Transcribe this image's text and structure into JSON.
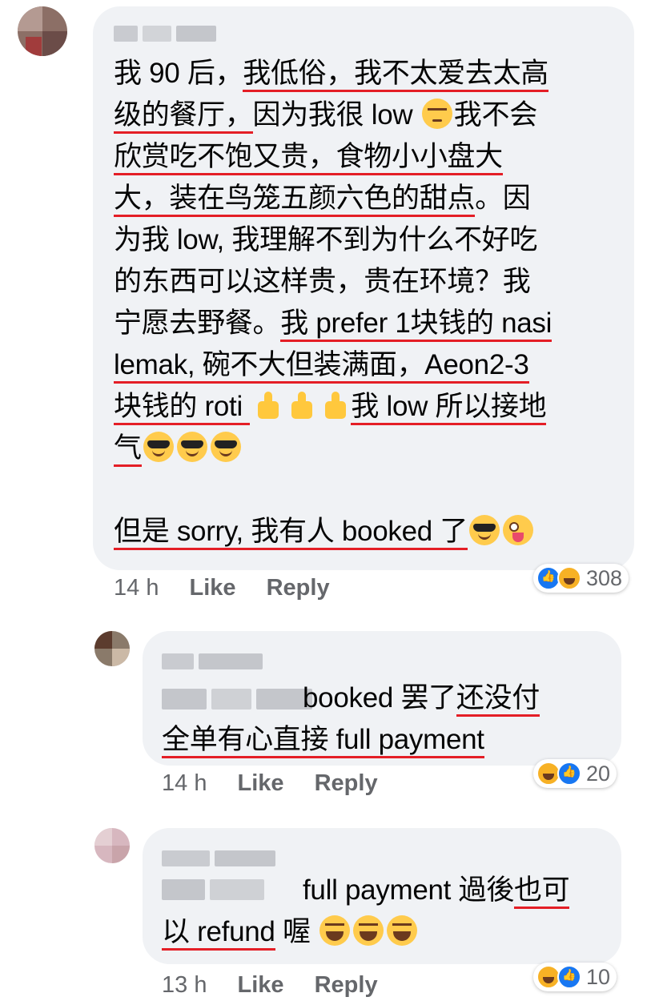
{
  "comments": [
    {
      "lines": [
        [
          {
            "t": "我 90 后，"
          },
          {
            "t": "我低俗，我不太爱去太高",
            "u": true
          }
        ],
        [
          {
            "t": "级的餐厅，",
            "u": true
          },
          {
            "t": "因为我很 low "
          },
          {
            "e": "unamused"
          },
          {
            "t": "我不会"
          }
        ],
        [
          {
            "t": "欣赏吃不饱又贵，食物小小盘大",
            "u": true
          }
        ],
        [
          {
            "t": "大，装在鸟笼五颜六色的甜点",
            "u": true
          },
          {
            "t": "。因"
          }
        ],
        [
          {
            "t": "为我 low, 我理解不到为什么不好吃"
          }
        ],
        [
          {
            "t": "的东西可以这样贵，贵在环境？我"
          }
        ],
        [
          {
            "t": "宁愿去野餐。"
          },
          {
            "t": "我 prefer 1块钱的 nasi",
            "u": true
          }
        ],
        [
          {
            "t": "lemak, 碗不大但装满面，Aeon2-3",
            "u": true
          }
        ],
        [
          {
            "t": "块钱的 roti ",
            "u": true
          },
          {
            "e": "thumb"
          },
          {
            "e": "thumb"
          },
          {
            "e": "thumb"
          },
          {
            "t": "我 low 所以接地",
            "u": true
          }
        ],
        [
          {
            "t": "气",
            "u": true
          },
          {
            "e": "glasses"
          },
          {
            "e": "glasses"
          },
          {
            "e": "glasses"
          }
        ],
        [],
        [
          {
            "t": "但是 sorry, 我有人 booked 了",
            "u": true
          },
          {
            "e": "glasses"
          },
          {
            "e": "crazy"
          }
        ]
      ],
      "time": "14 h",
      "like_label": "Like",
      "reply_label": "Reply",
      "reaction_count": "308",
      "reactions": [
        "like",
        "haha"
      ]
    },
    {
      "lines": [
        [
          {
            "t": "booked 罢了"
          },
          {
            "t": "还没付",
            "u": true
          }
        ],
        [
          {
            "t": "全单有心直接 full payment",
            "u": true
          }
        ]
      ],
      "time": "14 h",
      "like_label": "Like",
      "reply_label": "Reply",
      "reaction_count": "20",
      "reactions": [
        "haha",
        "like"
      ]
    },
    {
      "lines": [
        [
          {
            "t": "full payment 過後"
          },
          {
            "t": "也可",
            "u": true
          }
        ],
        [
          {
            "t": "以 refund",
            "u": true
          },
          {
            "t": " 喔 "
          },
          {
            "e": "laugh"
          },
          {
            "e": "laugh"
          },
          {
            "e": "laugh"
          }
        ]
      ],
      "time": "13 h",
      "like_label": "Like",
      "reply_label": "Reply",
      "reaction_count": "10",
      "reactions": [
        "haha",
        "like"
      ]
    }
  ],
  "colors": {
    "bubble": "#f0f2f5",
    "underline": "#e41e26",
    "meta": "#65676b",
    "like": "#1877f2",
    "haha": "#f7b125"
  }
}
